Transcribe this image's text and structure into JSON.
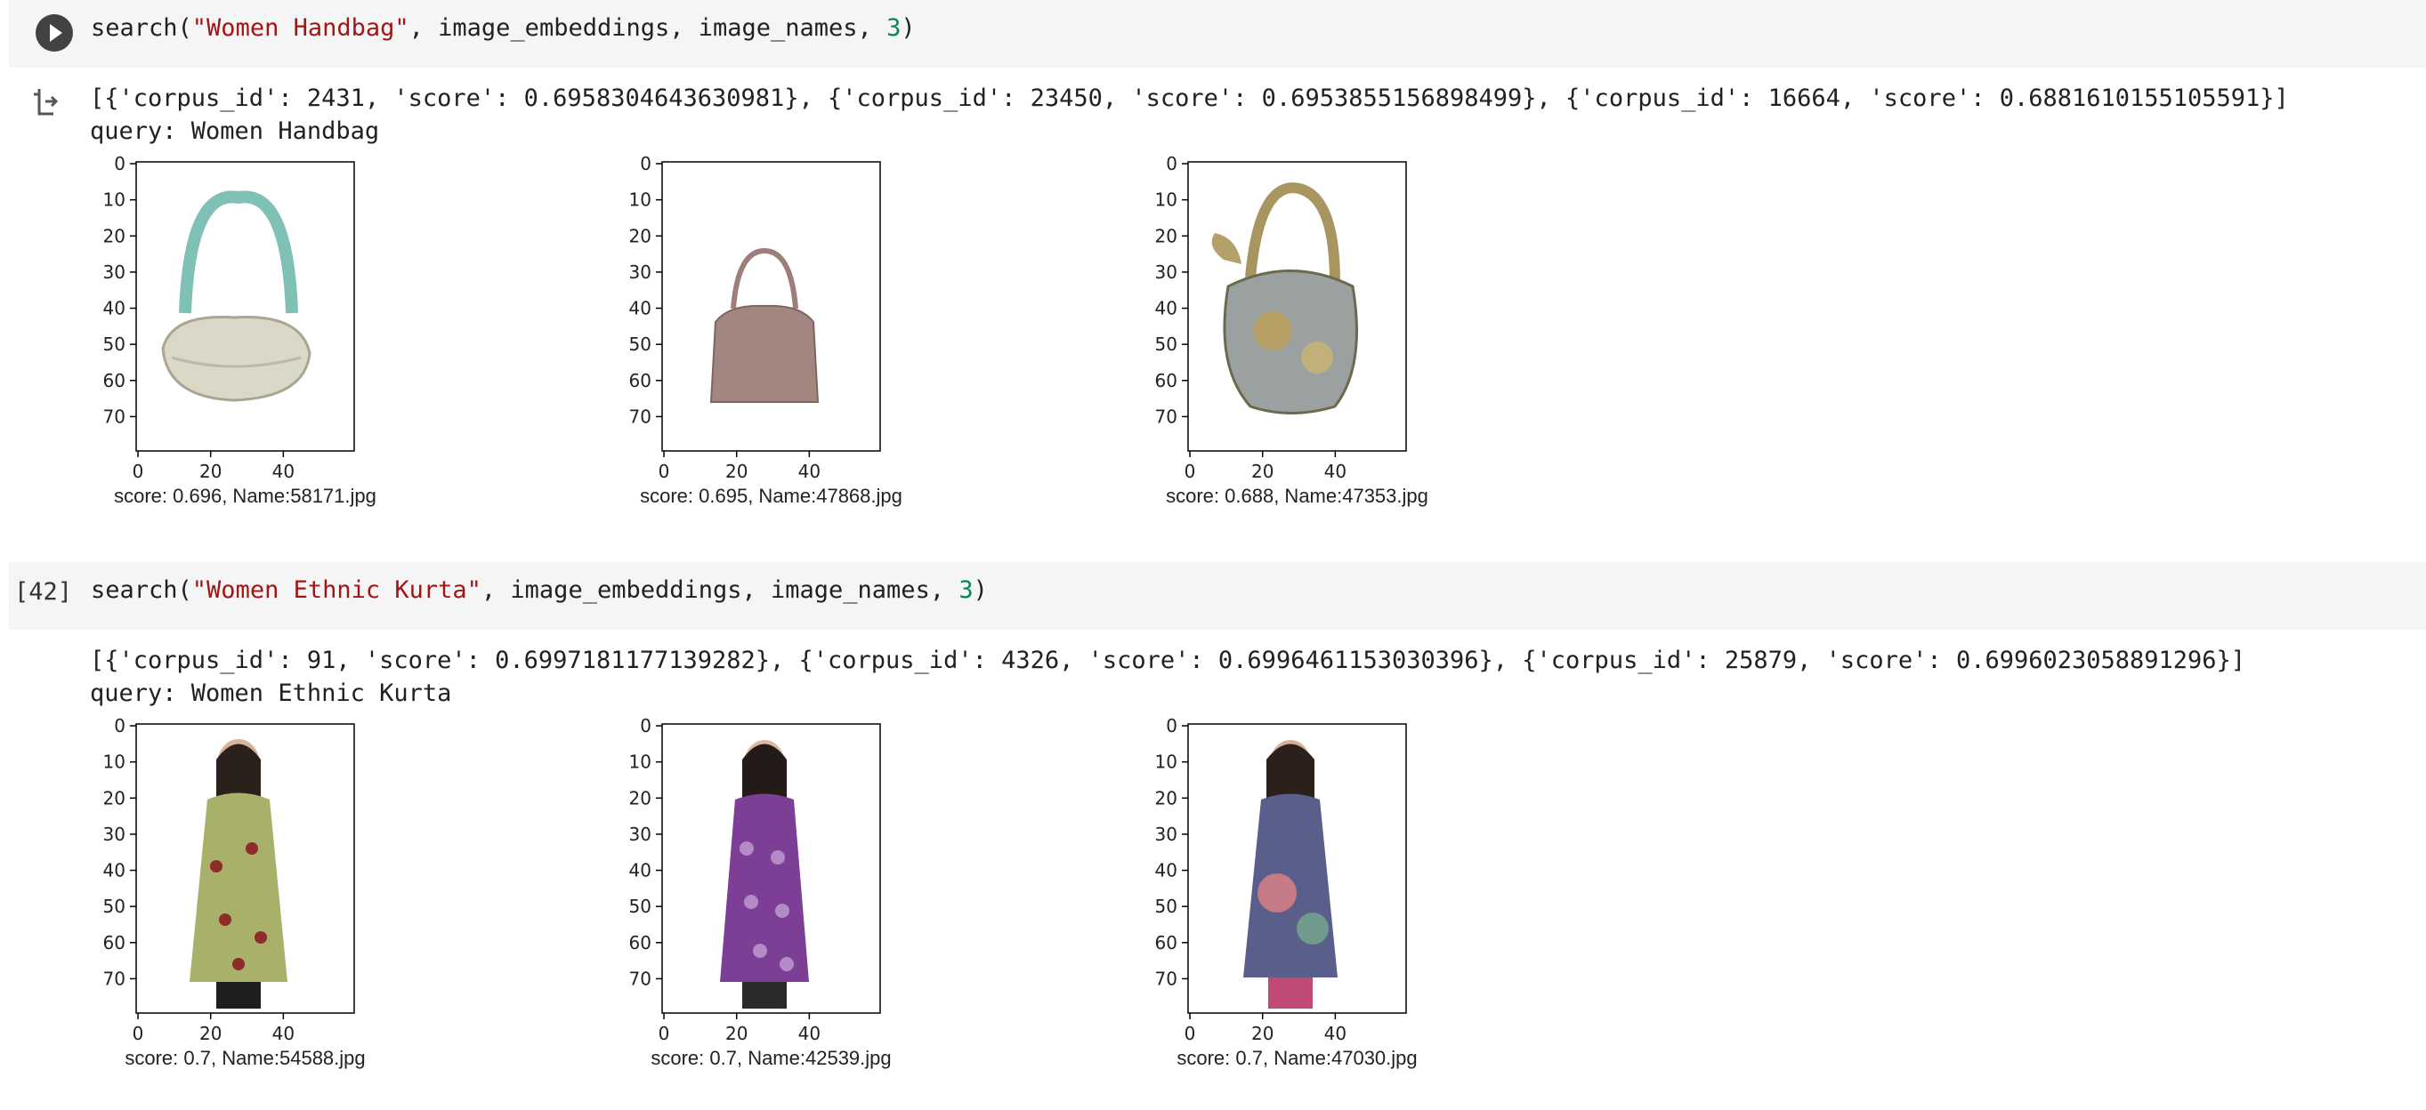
{
  "cells": [
    {
      "exec_label": "",
      "code": {
        "fn": "search(",
        "query": "\"Women Handbag\"",
        "args": ", image_embeddings, image_names, ",
        "k": "3",
        "close": ")"
      },
      "output": {
        "result_line": "[{'corpus_id': 2431, 'score': 0.6958304643630981}, {'corpus_id': 23450, 'score': 0.6953855156898499}, {'corpus_id': 16664, 'score': 0.6881610155105591}]",
        "query_line": "query: Women Handbag",
        "plots": [
          {
            "caption": "score: 0.696, Name:58171.jpg",
            "image": "teal-strap-cream-handbag"
          },
          {
            "caption": "score: 0.695, Name:47868.jpg",
            "image": "taupe-shoulder-handbag"
          },
          {
            "caption": "score: 0.688, Name:47353.jpg",
            "image": "paisley-print-handbag"
          }
        ]
      }
    },
    {
      "exec_label": "[42]",
      "code": {
        "fn": "search(",
        "query": "\"Women Ethnic Kurta\"",
        "args": ", image_embeddings, image_names, ",
        "k": "3",
        "close": ")"
      },
      "output": {
        "result_line": "[{'corpus_id': 91, 'score': 0.6997181177139282}, {'corpus_id': 4326, 'score': 0.6996461153030396}, {'corpus_id': 25879, 'score': 0.6996023058891296}]",
        "query_line": "query: Women Ethnic Kurta",
        "plots": [
          {
            "caption": "score: 0.7, Name:54588.jpg",
            "image": "green-floral-kurta-model"
          },
          {
            "caption": "score: 0.7, Name:42539.jpg",
            "image": "purple-print-kurta-model"
          },
          {
            "caption": "score: 0.7, Name:47030.jpg",
            "image": "multicolor-print-kurta-model"
          }
        ]
      }
    }
  ],
  "axes": {
    "y_ticks": [
      "0",
      "10",
      "20",
      "30",
      "40",
      "50",
      "60",
      "70"
    ],
    "x_ticks": [
      "0",
      "20",
      "40"
    ]
  },
  "colors": {
    "cell_bg": "#f5f5f5",
    "string": "#a31515",
    "number": "#098658",
    "run_button": "#424242"
  }
}
